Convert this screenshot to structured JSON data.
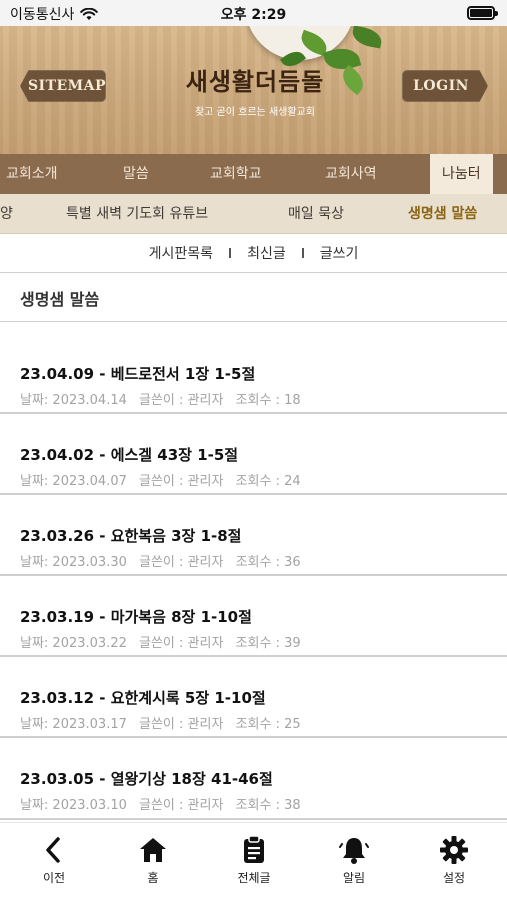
{
  "status_bar": {
    "carrier": "이동통신사",
    "time": "오후 2:29"
  },
  "banner": {
    "sitemap_label": "SITEMAP",
    "login_label": "LOGIN",
    "logo_title": "새생활더듬돌",
    "logo_subtitle": "찾고 곧이 흐르는 새생활교회"
  },
  "main_nav": {
    "items": [
      {
        "label": "교회소개"
      },
      {
        "label": "말씀"
      },
      {
        "label": "교회학교"
      },
      {
        "label": "교회사역"
      },
      {
        "label": "나눔터"
      }
    ]
  },
  "sub_nav": {
    "items": [
      {
        "label": "양"
      },
      {
        "label": "특별 새벽 기도회 유튜브"
      },
      {
        "label": "매일 묵상"
      },
      {
        "label": "생명샘 말씀"
      }
    ]
  },
  "board_links": {
    "list": "게시판목록",
    "recent": "최신글",
    "write": "글쓰기"
  },
  "board_title": "생명샘 말씀",
  "posts": [
    {
      "title": "23.04.09 - 베드로전서 1장 1-5절",
      "date": "날짜: 2023.04.14",
      "author": "글쓴이 : 관리자",
      "views": "조회수 : 18"
    },
    {
      "title": "23.04.02 - 에스겔 43장 1-5절",
      "date": "날짜: 2023.04.07",
      "author": "글쓴이 : 관리자",
      "views": "조회수 : 24"
    },
    {
      "title": "23.03.26 - 요한복음 3장 1-8절",
      "date": "날짜: 2023.03.30",
      "author": "글쓴이 : 관리자",
      "views": "조회수 : 36"
    },
    {
      "title": "23.03.19 - 마가복음 8장 1-10절",
      "date": "날짜: 2023.03.22",
      "author": "글쓴이 : 관리자",
      "views": "조회수 : 39"
    },
    {
      "title": "23.03.12 - 요한계시록 5장 1-10절",
      "date": "날짜: 2023.03.17",
      "author": "글쓴이 : 관리자",
      "views": "조회수 : 25"
    },
    {
      "title": "23.03.05 - 열왕기상 18장 41-46절",
      "date": "날짜: 2023.03.10",
      "author": "글쓴이 : 관리자",
      "views": "조회수 : 38"
    }
  ],
  "tab_bar": {
    "items": [
      {
        "label": "이전",
        "icon": "back-icon"
      },
      {
        "label": "홈",
        "icon": "home-icon"
      },
      {
        "label": "전체글",
        "icon": "clipboard-icon"
      },
      {
        "label": "알림",
        "icon": "bell-icon"
      },
      {
        "label": "설정",
        "icon": "gear-icon"
      }
    ]
  },
  "colors": {
    "accent": "#8a6413",
    "nav_bg": "#8a6b4e",
    "subnav_bg": "#e9dfcf"
  }
}
